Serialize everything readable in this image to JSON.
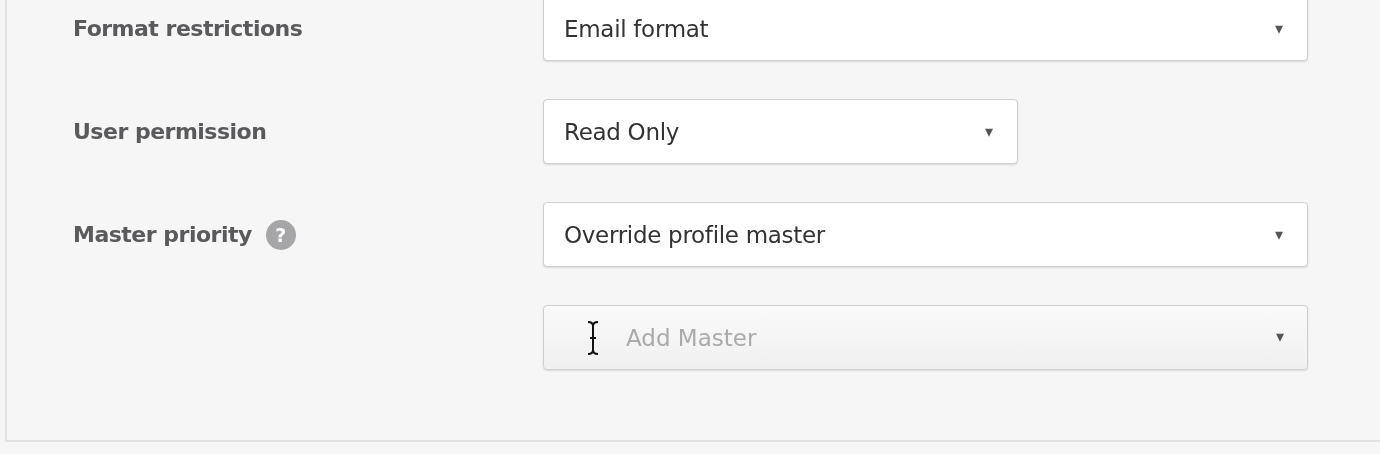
{
  "fields": [
    {
      "label": "Format restrictions",
      "kind": "select",
      "value": "Email format",
      "caret": "▾"
    },
    {
      "label": "User permission",
      "kind": "compact_select",
      "value": "Read Only",
      "caret": "▾"
    },
    {
      "label": "Master priority",
      "help": "?",
      "kind": "select",
      "value": "Override profile master",
      "caret": "▾"
    },
    {
      "kind": "combobox",
      "placeholder": "Add Master",
      "caret": "▾"
    }
  ]
}
